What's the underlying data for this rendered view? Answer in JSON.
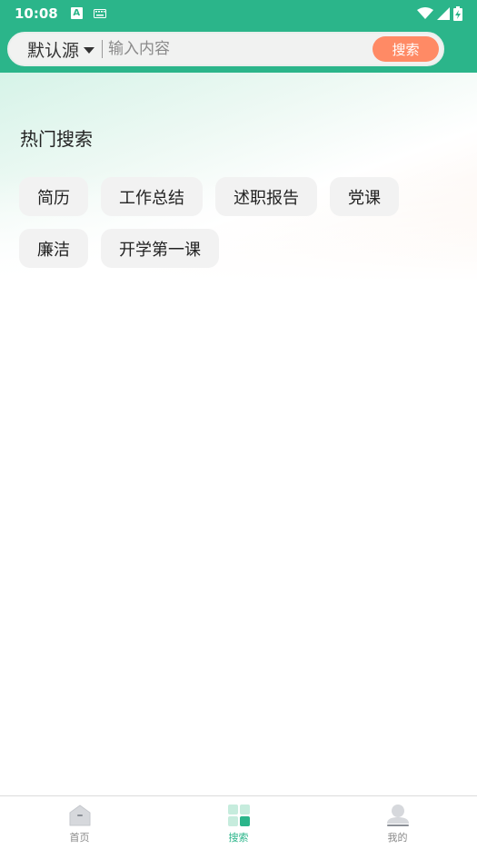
{
  "status_bar": {
    "time": "10:08",
    "app_icon_letter": "A",
    "keyboard_icon": "keyboard-icon",
    "wifi_icon": "wifi-icon",
    "signal_icon": "signal-icon",
    "battery_icon": "battery-charging-icon"
  },
  "search": {
    "source_label": "默认源",
    "placeholder": "输入内容",
    "button_label": "搜索"
  },
  "hot": {
    "title": "热门搜索",
    "tags": [
      "简历",
      "工作总结",
      "述职报告",
      "党课",
      "廉洁",
      "开学第一课"
    ]
  },
  "nav": {
    "items": [
      {
        "label": "首页",
        "icon": "home-icon",
        "active": false
      },
      {
        "label": "搜索",
        "icon": "grid-icon",
        "active": true
      },
      {
        "label": "我的",
        "icon": "user-icon",
        "active": false
      }
    ]
  },
  "colors": {
    "primary": "#2bb58a",
    "button": "#ff8a65"
  }
}
